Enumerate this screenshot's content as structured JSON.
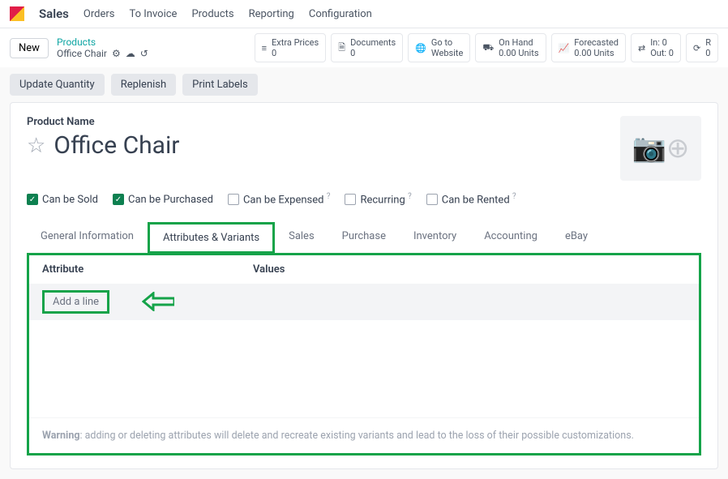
{
  "nav": {
    "main": "Sales",
    "links": [
      "Orders",
      "To Invoice",
      "Products",
      "Reporting",
      "Configuration"
    ]
  },
  "subbar": {
    "new_label": "New",
    "breadcrumb_top": "Products",
    "breadcrumb_bottom": "Office Chair"
  },
  "stats": {
    "extra_prices": {
      "label": "Extra Prices",
      "value": "0"
    },
    "documents": {
      "label": "Documents",
      "value": "0"
    },
    "goto": {
      "line1": "Go to",
      "line2": "Website"
    },
    "onhand": {
      "label": "On Hand",
      "value": "0.00 Units"
    },
    "forecasted": {
      "label": "Forecasted",
      "value": "0.00 Units"
    },
    "inout": {
      "in": "In: 0",
      "out": "Out: 0"
    },
    "refresh": {
      "label": "R",
      "value": "0"
    }
  },
  "actions": {
    "update_qty": "Update Quantity",
    "replenish": "Replenish",
    "print_labels": "Print Labels"
  },
  "form": {
    "name_label": "Product Name",
    "title": "Office Chair",
    "checks": {
      "sold": "Can be Sold",
      "purchased": "Can be Purchased",
      "expensed": "Can be Expensed",
      "recurring": "Recurring",
      "rented": "Can be Rented"
    },
    "tabs": {
      "general": "General Information",
      "attributes": "Attributes & Variants",
      "sales": "Sales",
      "purchase": "Purchase",
      "inventory": "Inventory",
      "accounting": "Accounting",
      "ebay": "eBay"
    },
    "table": {
      "col_attribute": "Attribute",
      "col_values": "Values",
      "add_line": "Add a line"
    },
    "warning_label": "Warning",
    "warning_text": ": adding or deleting attributes will delete and recreate existing variants and lead to the loss of their possible customizations."
  }
}
